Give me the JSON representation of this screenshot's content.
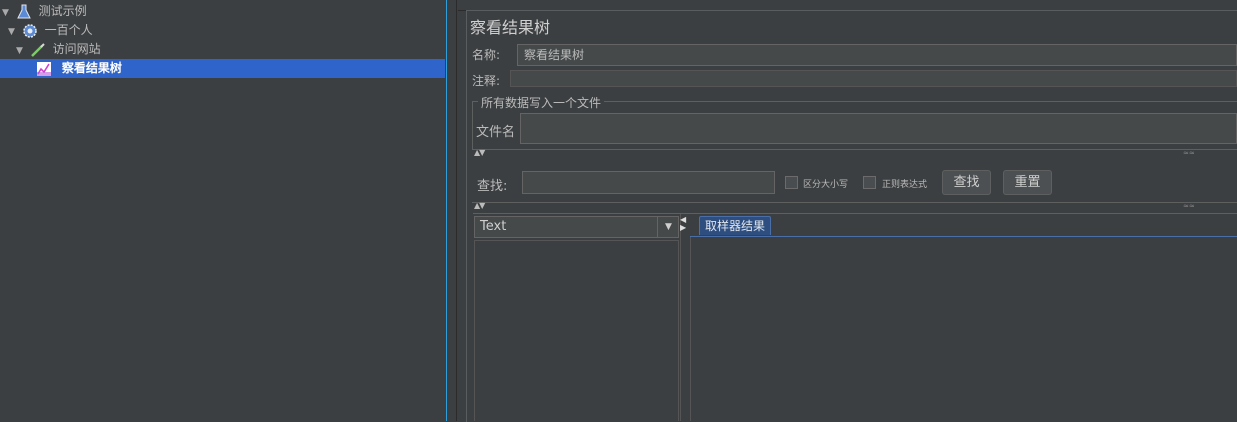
{
  "tree": {
    "items": [
      {
        "label": "测试示例",
        "icon": "flask-icon",
        "expanded": true,
        "depth": 0
      },
      {
        "label": "一百个人",
        "icon": "gear-icon",
        "expanded": true,
        "depth": 1
      },
      {
        "label": "访问网站",
        "icon": "pipette-icon",
        "expanded": true,
        "depth": 2
      },
      {
        "label": "察看结果树",
        "icon": "chart-icon",
        "selected": true,
        "depth": 3
      }
    ]
  },
  "panel": {
    "title": "察看结果树",
    "name_label": "名称:",
    "name_value": "察看结果树",
    "comment_label": "注释:",
    "comment_value": "",
    "group_title": "所有数据写入一个文件",
    "filename_label": "文件名",
    "filename_value": ""
  },
  "search": {
    "label": "查找:",
    "value": "",
    "case_label": "区分大小写",
    "regex_label": "正则表达式",
    "find_button": "查找",
    "reset_button": "重置"
  },
  "results": {
    "renderer": "Text",
    "tab_label": "取样器结果"
  },
  "colors": {
    "background": "#3c3f41",
    "selection": "#2f65ca",
    "tab": "#2e4e80"
  }
}
